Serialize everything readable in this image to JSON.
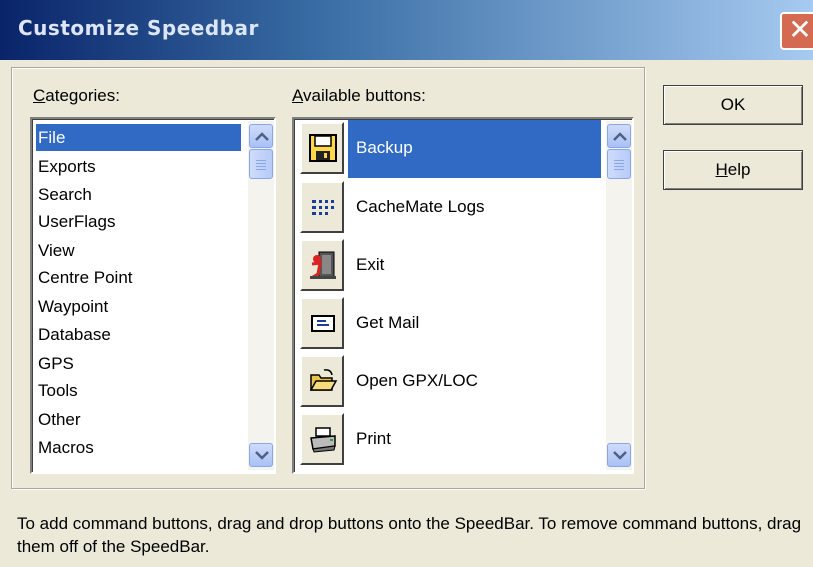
{
  "window": {
    "title": "Customize Speedbar",
    "close_glyph": "✕"
  },
  "categories": {
    "label_accel": "C",
    "label_rest": "ategories:",
    "items": [
      "File",
      "Exports",
      "Search",
      "UserFlags",
      "View",
      "Centre Point",
      "Waypoint",
      "Database",
      "GPS",
      "Tools",
      "Other",
      "Macros"
    ],
    "selected_index": 0
  },
  "available": {
    "label_accel": "A",
    "label_rest": "vailable buttons:",
    "items": [
      {
        "label": "Backup",
        "icon": "floppy-disk-icon"
      },
      {
        "label": "CacheMate Logs",
        "icon": "dotted-list-icon"
      },
      {
        "label": "Exit",
        "icon": "exit-door-icon"
      },
      {
        "label": "Get Mail",
        "icon": "mail-envelope-icon"
      },
      {
        "label": "Open GPX/LOC",
        "icon": "open-folder-icon"
      },
      {
        "label": "Print",
        "icon": "printer-icon"
      }
    ],
    "selected_index": 0
  },
  "buttons": {
    "ok": "OK",
    "help_accel": "H",
    "help_rest": "elp"
  },
  "hint": "To add command buttons, drag and drop buttons onto the SpeedBar. To remove command buttons, drag them off of the SpeedBar."
}
